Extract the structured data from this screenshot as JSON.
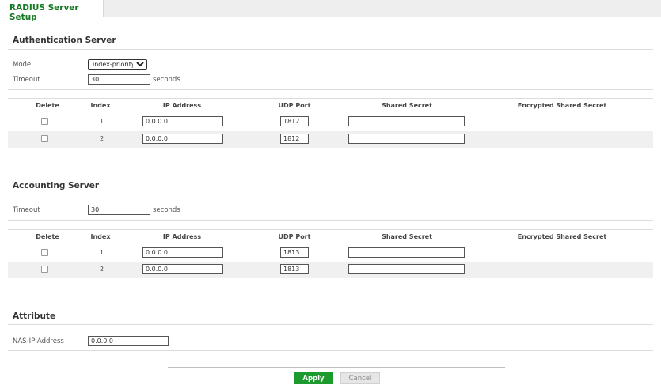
{
  "tab": {
    "label": "RADIUS Server Setup"
  },
  "auth": {
    "title": "Authentication Server",
    "mode_label": "Mode",
    "mode_value": "index-priority",
    "timeout_label": "Timeout",
    "timeout_value": "30",
    "timeout_unit": "seconds",
    "columns": [
      "Delete",
      "Index",
      "IP Address",
      "UDP Port",
      "Shared Secret",
      "Encrypted Shared Secret"
    ],
    "rows": [
      {
        "index": "1",
        "ip": "0.0.0.0",
        "port": "1812",
        "secret": ""
      },
      {
        "index": "2",
        "ip": "0.0.0.0",
        "port": "1812",
        "secret": ""
      }
    ]
  },
  "acct": {
    "title": "Accounting Server",
    "timeout_label": "Timeout",
    "timeout_value": "30",
    "timeout_unit": "seconds",
    "columns": [
      "Delete",
      "Index",
      "IP Address",
      "UDP Port",
      "Shared Secret",
      "Encrypted Shared Secret"
    ],
    "rows": [
      {
        "index": "1",
        "ip": "0.0.0.0",
        "port": "1813",
        "secret": ""
      },
      {
        "index": "2",
        "ip": "0.0.0.0",
        "port": "1813",
        "secret": ""
      }
    ]
  },
  "attribute": {
    "title": "Attribute",
    "nas_label": "NAS-IP-Address",
    "nas_value": "0.0.0.0"
  },
  "actions": {
    "apply": "Apply",
    "cancel": "Cancel"
  }
}
